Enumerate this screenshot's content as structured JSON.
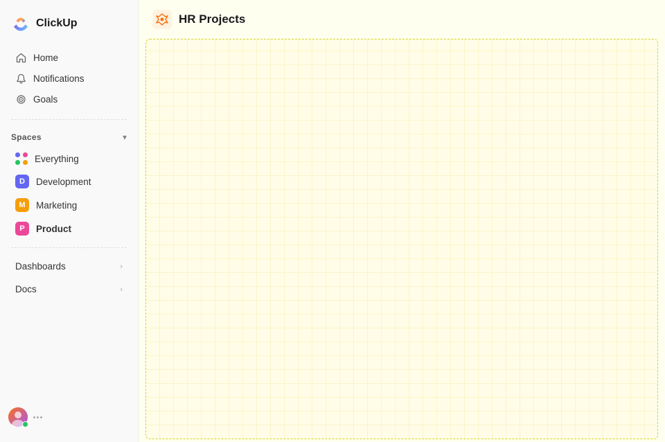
{
  "logo": {
    "text": "ClickUp"
  },
  "sidebar": {
    "nav": [
      {
        "id": "home",
        "label": "Home",
        "icon": "home"
      },
      {
        "id": "notifications",
        "label": "Notifications",
        "icon": "bell"
      },
      {
        "id": "goals",
        "label": "Goals",
        "icon": "target"
      }
    ],
    "spaces_section": {
      "label": "Spaces",
      "chevron": "▾"
    },
    "spaces": [
      {
        "id": "everything",
        "label": "Everything",
        "type": "dots"
      },
      {
        "id": "development",
        "label": "Development",
        "type": "badge",
        "badge_letter": "D",
        "badge_color": "#6366f1"
      },
      {
        "id": "marketing",
        "label": "Marketing",
        "type": "badge",
        "badge_letter": "M",
        "badge_color": "#f59e0b"
      },
      {
        "id": "product",
        "label": "Product",
        "type": "badge",
        "badge_letter": "P",
        "badge_color": "#ec4899",
        "active": true
      }
    ],
    "expandable": [
      {
        "id": "dashboards",
        "label": "Dashboards"
      },
      {
        "id": "docs",
        "label": "Docs"
      }
    ]
  },
  "header": {
    "title": "HR Projects",
    "icon_color": "#f97316"
  },
  "dots_colors": [
    "#6366f1",
    "#ec4899",
    "#22c55e",
    "#f59e0b"
  ]
}
